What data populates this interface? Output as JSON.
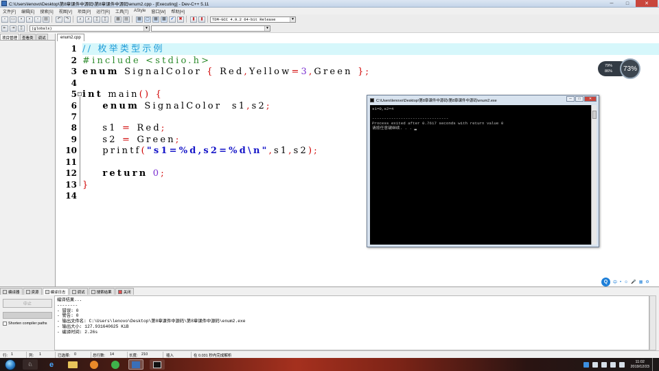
{
  "window": {
    "title": "C:\\Users\\lenovo\\Desktop\\第8章课件中源码\\第8章课件中源码\\enum2.cpp - [Executing] - Dev-C++ 5.11",
    "controls": [
      "─",
      "□",
      "✕"
    ]
  },
  "menu": [
    "文件[F]",
    "编辑[E]",
    "搜索[S]",
    "视图[V]",
    "项目[P]",
    "运行[R]",
    "工具[T]",
    "AStyle",
    "窗口[W]",
    "帮助[H]"
  ],
  "toolbar": {
    "compiler": "TDM-GCC 4.9.2 64-bit Release",
    "scope": "(globals)",
    "function": ""
  },
  "left_panel": {
    "tabs": [
      "项目管理",
      "查看类",
      "调试"
    ]
  },
  "editor": {
    "file_tab": "enum2.cpp",
    "line_numbers": [
      "1",
      "2",
      "3",
      "4",
      "5",
      "6",
      "7",
      "8",
      "9",
      "10",
      "11",
      "12",
      "13",
      "14"
    ]
  },
  "console": {
    "title": "C:\\Users\\lenovo\\Desktop\\第8章课件中源码\\第8章课件中源码\\enum2.exe",
    "output": "s1=0,s2=4\n\n--------------------------------\nProcess exited after 0.7617 seconds with return value 0\n请按任意键继续. . . ▂"
  },
  "monitor": {
    "stat1": "79%",
    "stat2": "86%",
    "value": "73%"
  },
  "ime": {
    "logo": "Q",
    "items": [
      "中",
      "•",
      "☺",
      "🎤",
      "▦",
      "⚙"
    ]
  },
  "bottom_panel": {
    "tabs": [
      "编译器",
      "资源",
      "编译日志",
      "调试",
      "搜索结果",
      "关闭"
    ],
    "abort_label": "中止",
    "shorten_label": "Shorten compiler paths",
    "log": "编译结果...\n--------\n- 错误: 0\n- 警告: 0\n- 输出文件名: C:\\Users\\lenovo\\Desktop\\第8章课件中源码\\第8章课件中源码\\enum2.exe\n- 输出大小: 127.931640625 KiB\n- 编译时间: 2.26s"
  },
  "statusbar": {
    "row_label": "行:",
    "row": "1",
    "col_label": "列:",
    "col": "1",
    "sel_label": "已选择:",
    "sel": "0",
    "total_label": "总行数:",
    "total": "14",
    "len_label": "长度:",
    "len": "210",
    "mode": "插入",
    "parse": "在 0.031 秒内完成解析"
  },
  "taskbar": {
    "time": "11:02",
    "date": "2019/12/23"
  }
}
